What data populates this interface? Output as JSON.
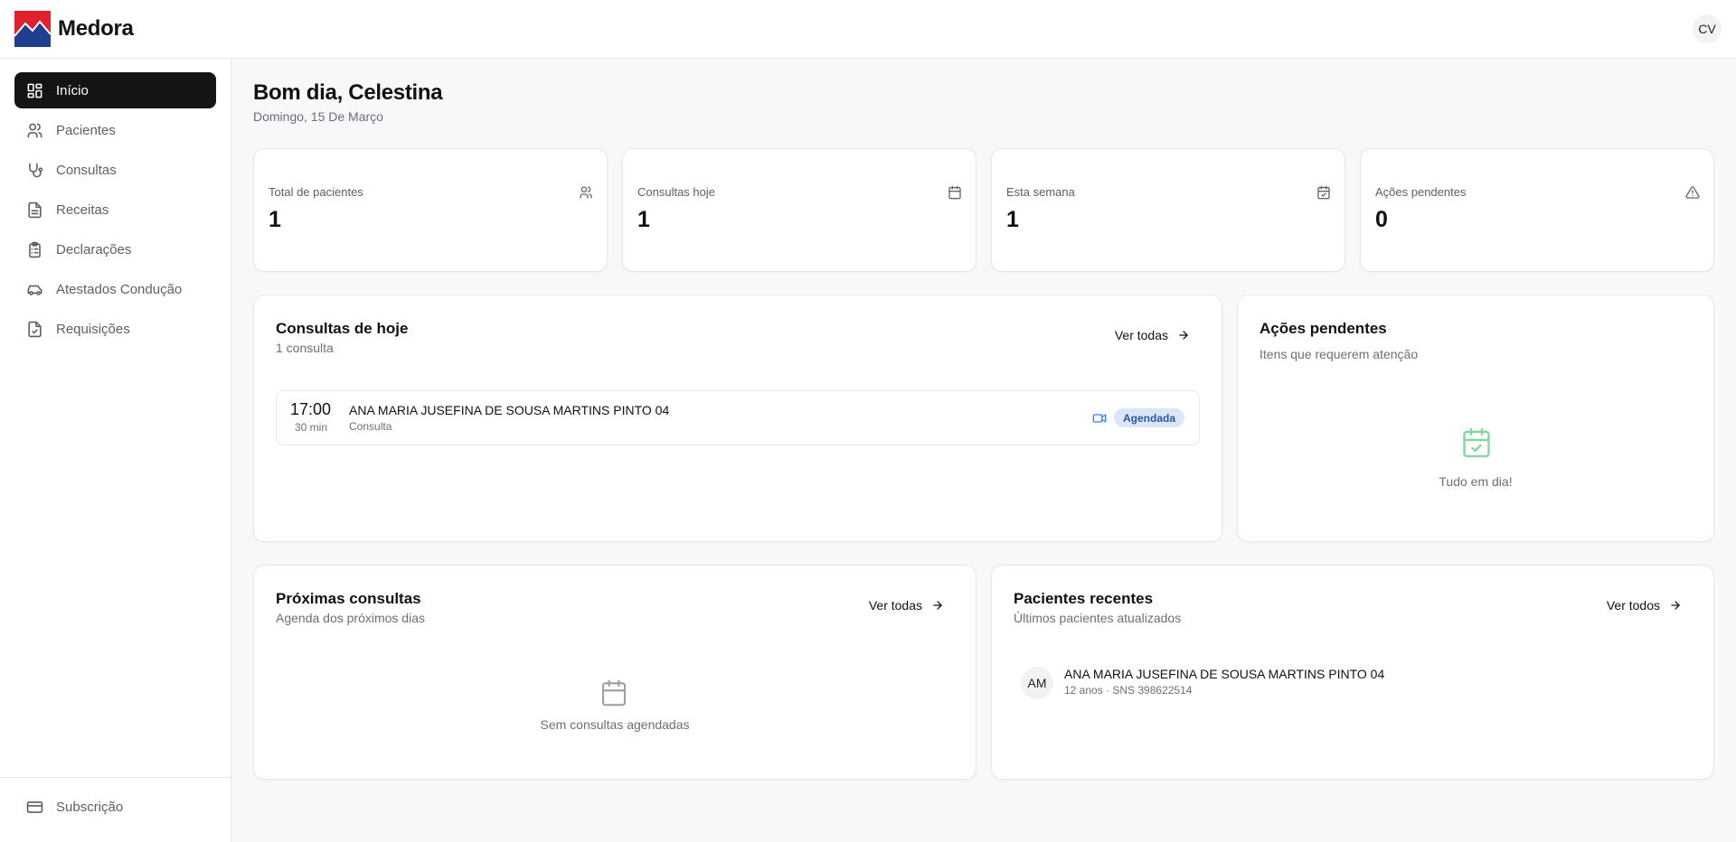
{
  "header": {
    "brand": "Medora",
    "user_initials": "CV"
  },
  "sidebar": {
    "items": [
      {
        "label": "Início",
        "icon": "dashboard-icon",
        "active": true
      },
      {
        "label": "Pacientes",
        "icon": "users-icon"
      },
      {
        "label": "Consultas",
        "icon": "stethoscope-icon"
      },
      {
        "label": "Receitas",
        "icon": "file-text-icon"
      },
      {
        "label": "Declarações",
        "icon": "clipboard-list-icon"
      },
      {
        "label": "Atestados Condução",
        "icon": "car-icon"
      },
      {
        "label": "Requisições",
        "icon": "file-check-icon"
      }
    ],
    "footer": {
      "label": "Subscrição",
      "icon": "credit-card-icon"
    }
  },
  "main": {
    "greeting": "Bom dia, Celestina",
    "date": "Domingo, 15 De Março",
    "stats": [
      {
        "label": "Total de pacientes",
        "value": "1",
        "icon": "users-icon"
      },
      {
        "label": "Consultas hoje",
        "value": "1",
        "icon": "calendar-icon"
      },
      {
        "label": "Esta semana",
        "value": "1",
        "icon": "calendar-check-icon"
      },
      {
        "label": "Ações pendentes",
        "value": "0",
        "icon": "alert-triangle-icon"
      }
    ],
    "today": {
      "title": "Consultas de hoje",
      "subtitle": "1 consulta",
      "link": "Ver todas",
      "appointment": {
        "time": "17:00",
        "duration": "30 min",
        "patient": "ANA MARIA JUSEFINA DE SOUSA MARTINS PINTO 04",
        "type": "Consulta",
        "status": "Agendada"
      }
    },
    "pending": {
      "title": "Ações pendentes",
      "subtitle": "Itens que requerem atenção",
      "empty": "Tudo em dia!"
    },
    "upcoming": {
      "title": "Próximas consultas",
      "subtitle": "Agenda dos próximos dias",
      "link": "Ver todas",
      "empty": "Sem consultas agendadas"
    },
    "recent": {
      "title": "Pacientes recentes",
      "subtitle": "Últimos pacientes atualizados",
      "link": "Ver todos",
      "patient": {
        "initials": "AM",
        "name": "ANA MARIA JUSEFINA DE SOUSA MARTINS PINTO 04",
        "meta": "12 anos · SNS 398622514"
      }
    }
  },
  "colors": {
    "accent_dark": "#141414",
    "badge_bg": "#dbe7f9",
    "badge_text": "#2759a8",
    "success": "#86d6a2",
    "logo_red": "#e0202c",
    "logo_blue": "#1f3f8f"
  }
}
